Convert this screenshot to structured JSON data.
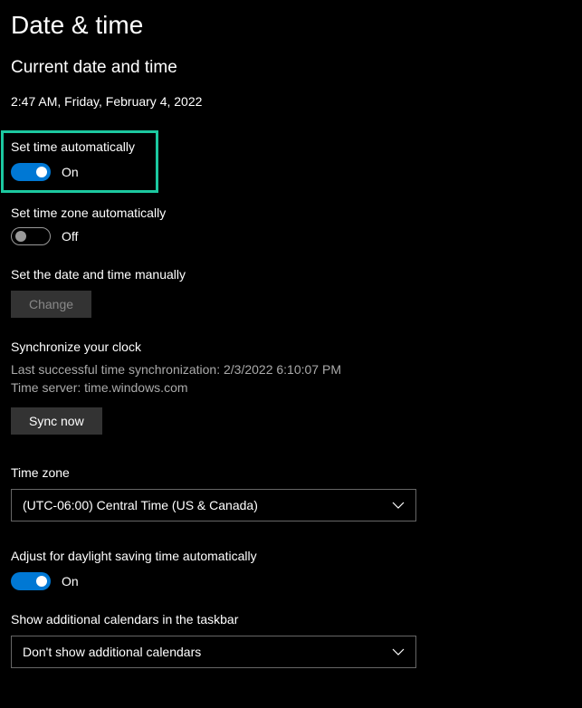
{
  "page_title": "Date & time",
  "section_heading": "Current date and time",
  "datetime_display": "2:47 AM, Friday, February 4, 2022",
  "set_time_auto": {
    "label": "Set time automatically",
    "state": "On"
  },
  "set_timezone_auto": {
    "label": "Set time zone automatically",
    "state": "Off"
  },
  "manual_datetime": {
    "label": "Set the date and time manually",
    "button": "Change"
  },
  "sync": {
    "heading": "Synchronize your clock",
    "last_sync": "Last successful time synchronization: 2/3/2022 6:10:07 PM",
    "server": "Time server: time.windows.com",
    "button": "Sync now"
  },
  "timezone": {
    "label": "Time zone",
    "value": "(UTC-06:00) Central Time (US & Canada)"
  },
  "dst": {
    "label": "Adjust for daylight saving time automatically",
    "state": "On"
  },
  "additional_calendars": {
    "label": "Show additional calendars in the taskbar",
    "value": "Don't show additional calendars"
  }
}
